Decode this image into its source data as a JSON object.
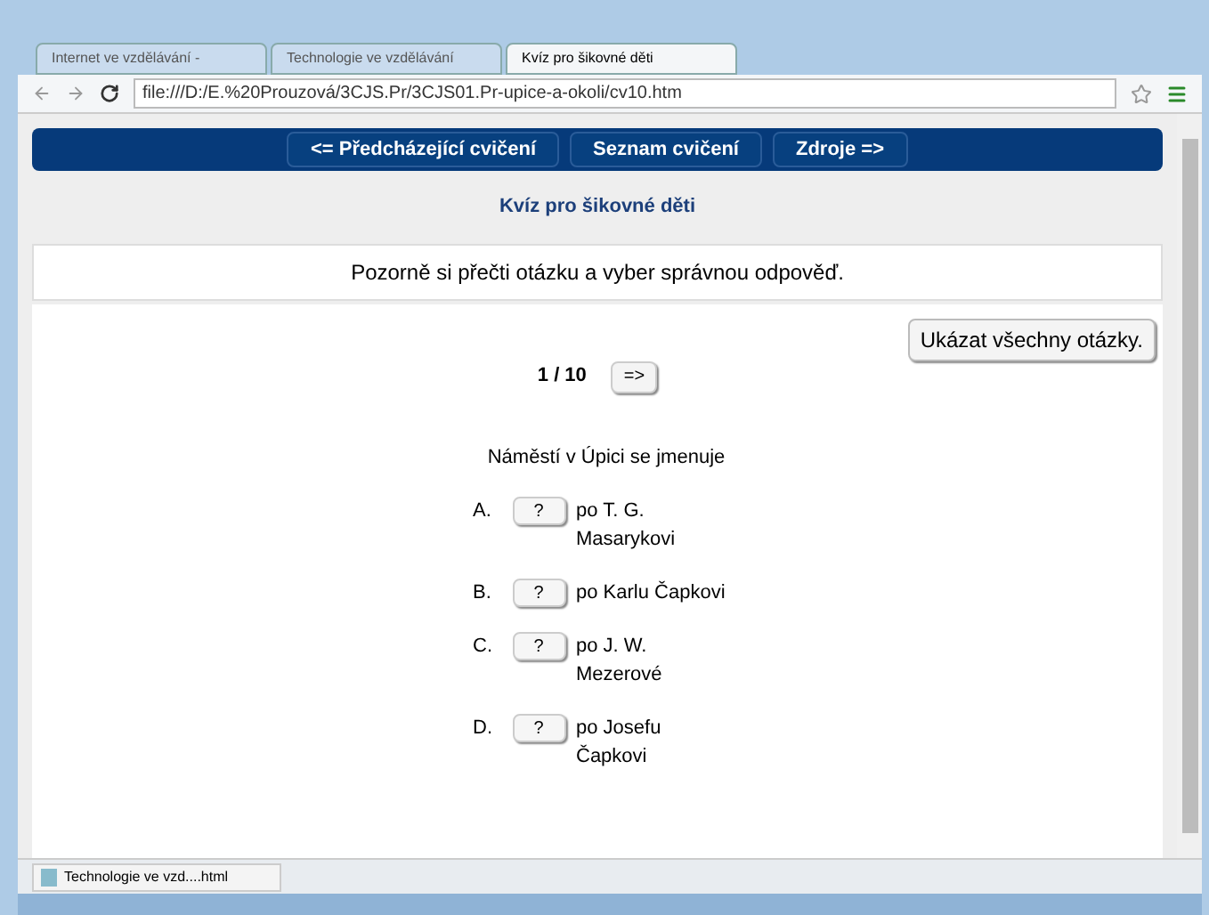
{
  "browser": {
    "tabs": [
      {
        "label": "Internet ve vzdělávání - ",
        "selected": false
      },
      {
        "label": "Technologie ve vzdělávání",
        "selected": false
      },
      {
        "label": "Kvíz pro šikovné děti",
        "selected": true
      }
    ],
    "address": "file:///D:/E.%20Prouzová/3CJS.Pr/3CJS01.Pr-upice-a-okoli/cv10.htm"
  },
  "nav": [
    "<= Předcházející cvičení",
    "Seznam cvičení",
    "Zdroje =>"
  ],
  "title": "Kvíz pro šikovné děti",
  "instruction": "Pozorně si přečti otázku a vyber správnou odpověď.",
  "show_all_button": "Ukázat všechny otázky.",
  "counter": "1 / 10",
  "next_button": "=>",
  "question": "Náměstí v Úpici se jmenuje",
  "answers": [
    {
      "letter": "A.",
      "button": "?",
      "text": "po T. G. Masarykovi"
    },
    {
      "letter": "B.",
      "button": "?",
      "text": "po Karlu Čapkovi"
    },
    {
      "letter": "C.",
      "button": "?",
      "text": "po J. W. Mezerové"
    },
    {
      "letter": "D.",
      "button": "?",
      "text": "po Josefu Čapkovi"
    }
  ],
  "downloads": [
    "Technologie ve vzd....html"
  ]
}
